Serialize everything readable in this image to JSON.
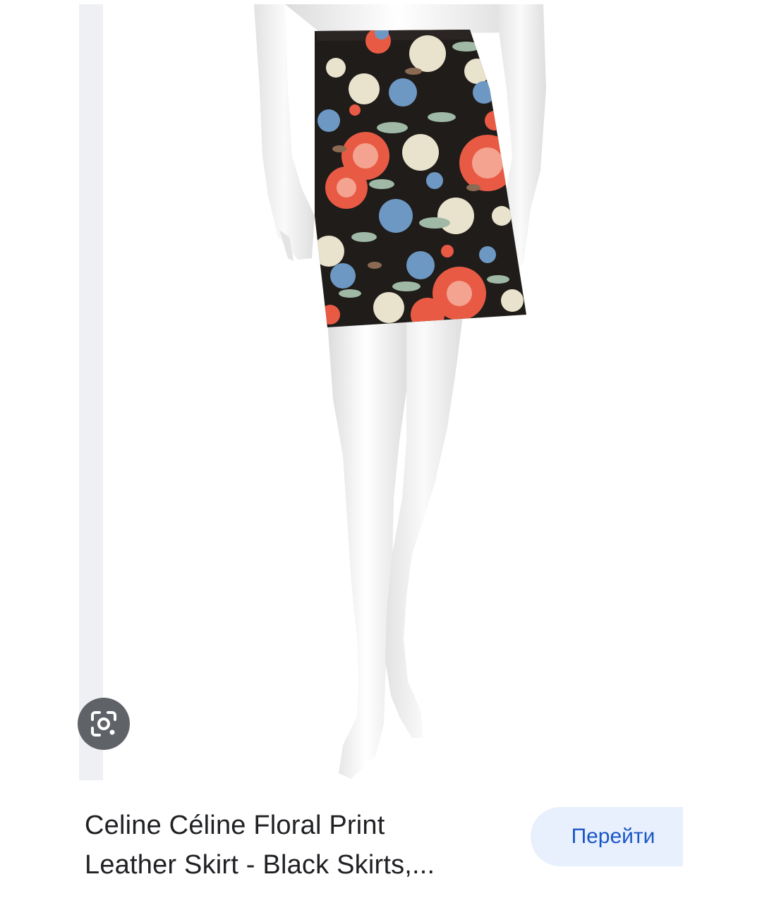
{
  "result": {
    "title_line_1": "Celine Céline Floral Print",
    "title_line_2": "Leather Skirt - Black Skirts,..."
  },
  "actions": {
    "visit_label": "Перейти",
    "lens_icon": "google-lens-icon"
  },
  "colors": {
    "visit_button_bg": "#e8f0fe",
    "visit_button_text": "#1a57c6",
    "lens_button_bg": "#5f6368",
    "side_strip": "#eef0f4"
  }
}
